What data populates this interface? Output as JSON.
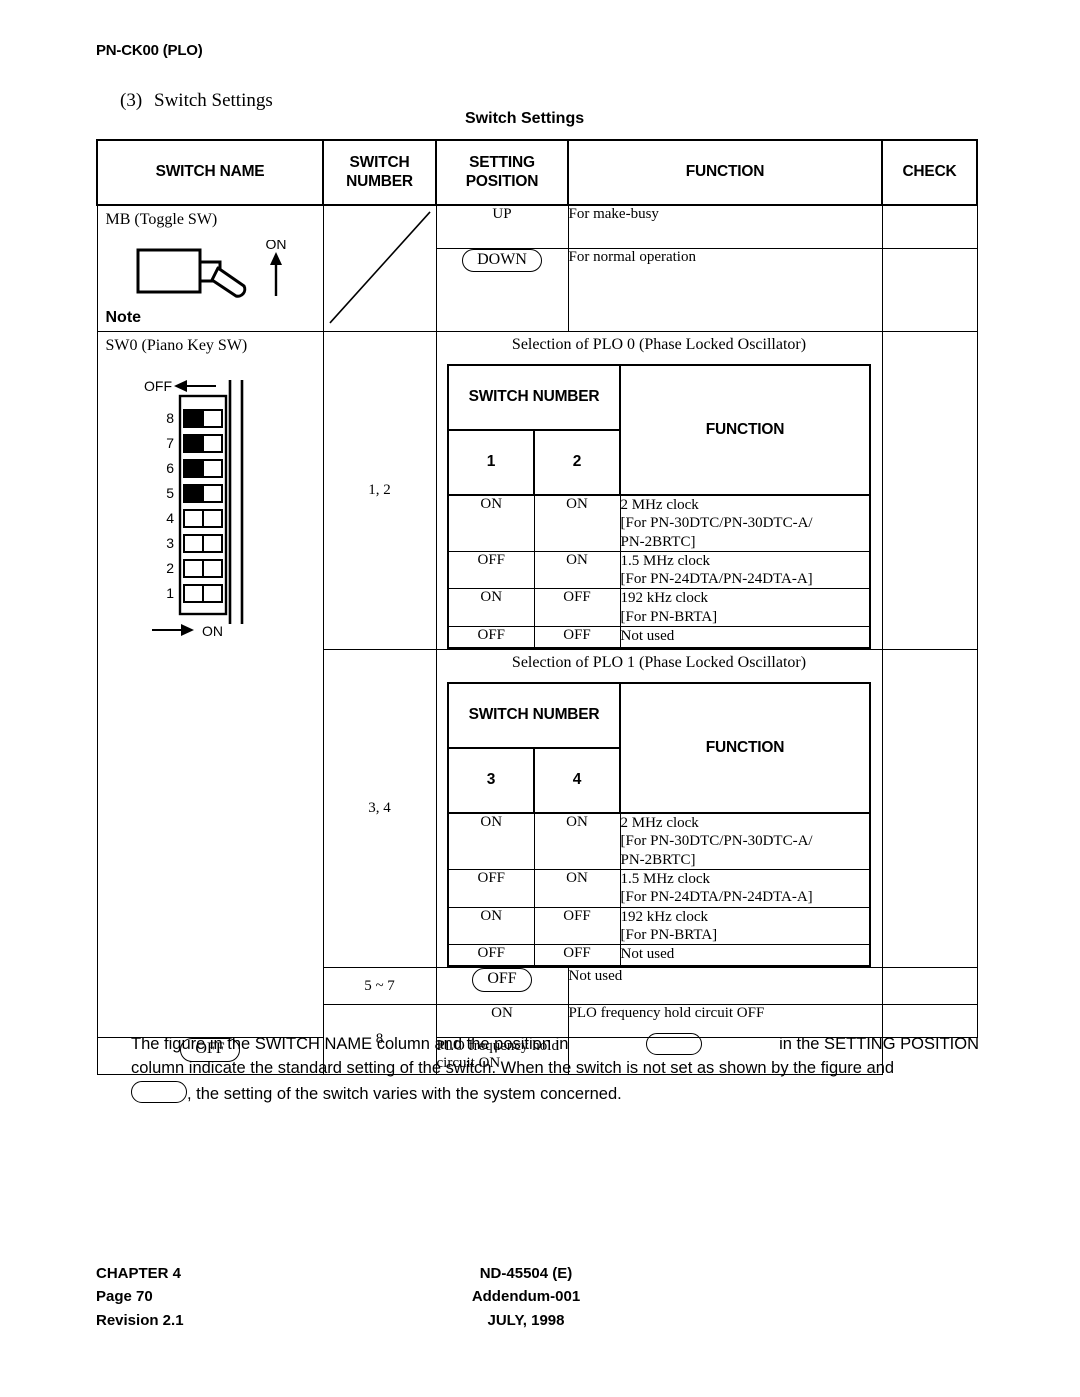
{
  "document": {
    "header_title": "PN-CK00 (PLO)",
    "section_number": "(3)",
    "section_title": "Switch Settings",
    "table_caption": "Switch Settings"
  },
  "table": {
    "headers": {
      "switch_name": "SWITCH NAME",
      "switch_number_l1": "SWITCH",
      "switch_number_l2": "NUMBER",
      "setting_position_l1": "SETTING",
      "setting_position_l2": "POSITION",
      "function": "FUNCTION",
      "check": "CHECK"
    },
    "mb_row": {
      "name": "MB (Toggle SW)",
      "note_label": "Note",
      "toggle_icon_label": "ON",
      "settings": [
        {
          "position": "UP",
          "standard": false,
          "function": "For make-busy"
        },
        {
          "position": "DOWN",
          "standard": true,
          "function": "For normal operation"
        }
      ]
    },
    "sw0_row": {
      "name": "SW0 (Piano Key SW)",
      "dip_figure": {
        "off_label": "OFF",
        "on_label": "ON",
        "switches": [
          {
            "number": "8",
            "state": "off"
          },
          {
            "number": "7",
            "state": "off"
          },
          {
            "number": "6",
            "state": "off"
          },
          {
            "number": "5",
            "state": "off"
          },
          {
            "number": "4",
            "state": "on"
          },
          {
            "number": "3",
            "state": "on"
          },
          {
            "number": "2",
            "state": "on"
          },
          {
            "number": "1",
            "state": "on"
          }
        ]
      },
      "plo0": {
        "switch_numbers": "1, 2",
        "title": "Selection of PLO 0 (Phase Locked Oscillator)",
        "header_switch_number": "SWITCH NUMBER",
        "header_function": "FUNCTION",
        "col1": "1",
        "col2": "2",
        "rows": [
          {
            "sw1": "ON",
            "sw2": "ON",
            "function": [
              "2 MHz clock",
              "[For PN-30DTC/PN-30DTC-A/",
              "PN-2BRTC]"
            ]
          },
          {
            "sw1": "OFF",
            "sw2": "ON",
            "function": [
              "1.5 MHz clock",
              "[For PN-24DTA/PN-24DTA-A]"
            ]
          },
          {
            "sw1": "ON",
            "sw2": "OFF",
            "function": [
              "192 kHz clock",
              "[For PN-BRTA]"
            ]
          },
          {
            "sw1": "OFF",
            "sw2": "OFF",
            "function": [
              "Not used"
            ]
          }
        ]
      },
      "plo1": {
        "switch_numbers": "3, 4",
        "title": "Selection of PLO 1 (Phase Locked Oscillator)",
        "header_switch_number": "SWITCH NUMBER",
        "header_function": "FUNCTION",
        "col1": "3",
        "col2": "4",
        "rows": [
          {
            "sw1": "ON",
            "sw2": "ON",
            "function": [
              "2 MHz clock",
              "[For PN-30DTC/PN-30DTC-A/",
              "PN-2BRTC]"
            ]
          },
          {
            "sw1": "OFF",
            "sw2": "ON",
            "function": [
              "1.5 MHz clock",
              "[For PN-24DTA/PN-24DTA-A]"
            ]
          },
          {
            "sw1": "ON",
            "sw2": "OFF",
            "function": [
              "192 kHz clock",
              "[For PN-BRTA]"
            ]
          },
          {
            "sw1": "OFF",
            "sw2": "OFF",
            "function": [
              "Not used"
            ]
          }
        ]
      },
      "row_5_7": {
        "switch_numbers": "5 ~ 7",
        "position": "OFF",
        "standard": true,
        "function": "Not used"
      },
      "row_8": {
        "switch_numbers": "8",
        "settings": [
          {
            "position": "ON",
            "standard": false,
            "function": "PLO frequency hold circuit OFF"
          },
          {
            "position": "OFF",
            "standard": true,
            "function": "PLO frequency hold circuit ON"
          }
        ]
      }
    }
  },
  "footnote": {
    "line1_a": "The figure in the SWITCH NAME column and the position in",
    "line1_b": "in the SETTING POSITION",
    "line2": "column indicate the standard setting of the switch. When the switch is not set as shown by the figure and",
    "line3": ", the setting of the switch varies with the system concerned."
  },
  "footer": {
    "chapter": "CHAPTER 4",
    "page": "Page 70",
    "revision": "Revision 2.1",
    "doc_number": "ND-45504 (E)",
    "addendum": "Addendum-001",
    "date": "JULY, 1998"
  }
}
